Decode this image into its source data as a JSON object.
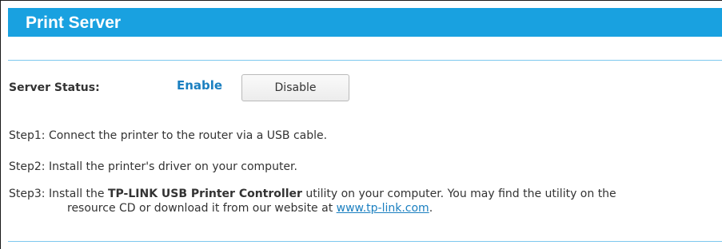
{
  "header": {
    "title": "Print Server"
  },
  "server_status": {
    "label": "Server Status:",
    "value": "Enable",
    "disable_button_label": "Disable"
  },
  "steps": {
    "step1": "Step1: Connect the printer to the router via a USB cable.",
    "step2": "Step2: Install the printer's driver on your computer.",
    "step3": {
      "prefix": "Step3: Install the ",
      "bold": "TP-LINK USB Printer Controller",
      "suffix": " utility on your computer. You may find the utility on the",
      "line2_prefix": "resource CD or download it from our website at ",
      "link": "www.tp-link.com",
      "line2_suffix": "."
    }
  },
  "colors": {
    "header_bg": "#19a1e0",
    "accent": "#1a7fc0",
    "divider": "#7dc8ee"
  }
}
